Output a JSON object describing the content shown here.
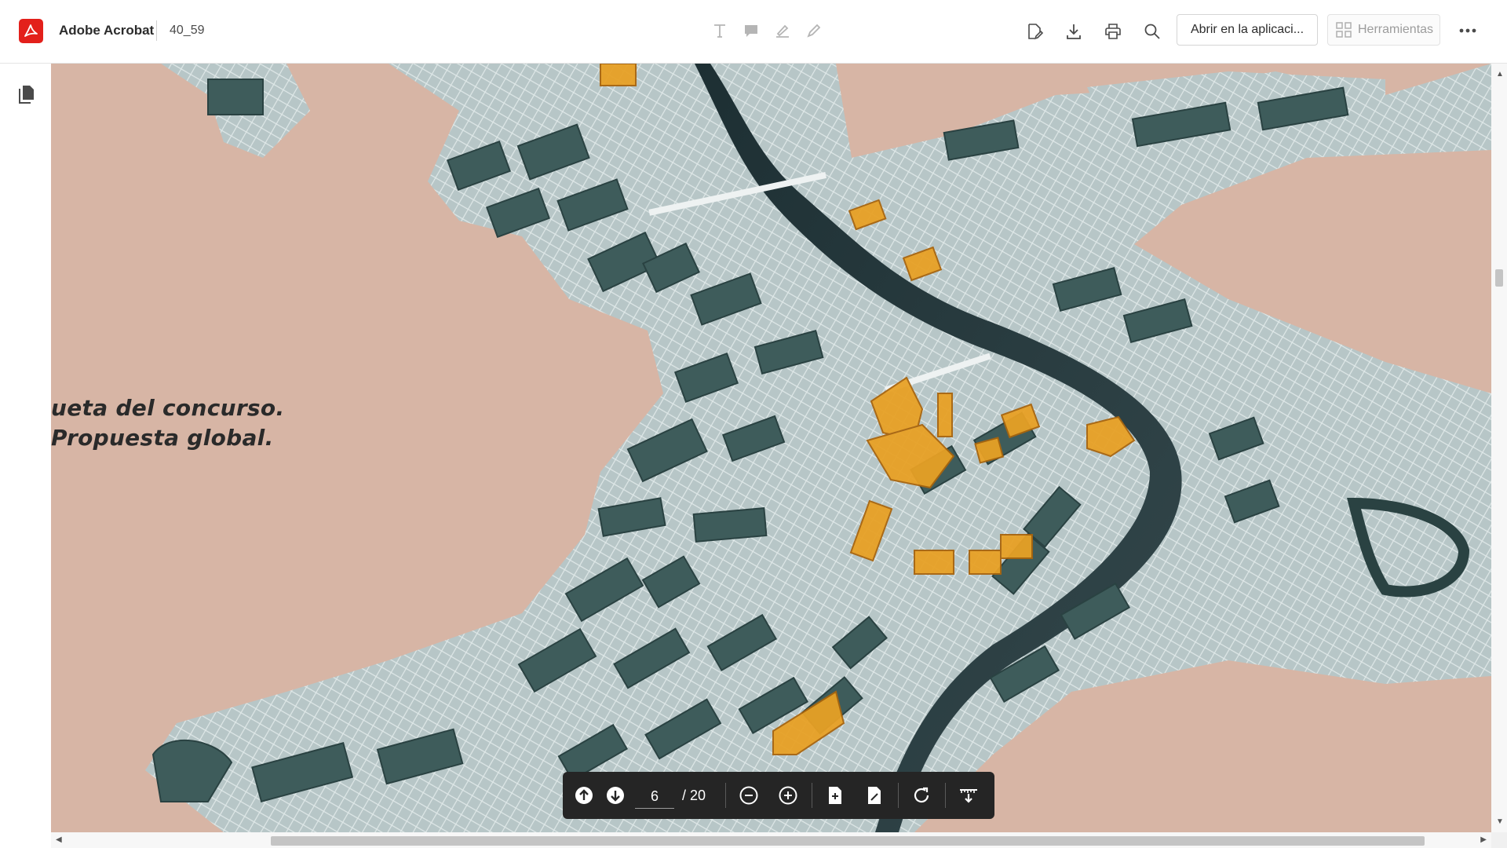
{
  "app": {
    "name": "Adobe Acrobat",
    "document_name": "40_59"
  },
  "toolbar": {
    "open_in_app_label": "Abrir en la aplicaci...",
    "tools_label": "Herramientas",
    "annotation_tools": [
      "text-tool-icon",
      "comment-icon",
      "highlight-icon",
      "pencil-icon"
    ],
    "right_icons": [
      "edit-pdf-icon",
      "download-icon",
      "print-icon",
      "search-icon"
    ]
  },
  "document": {
    "caption_line1": "ueta del concurso.",
    "caption_line2": "Propuesta global."
  },
  "page_nav": {
    "current_page": "6",
    "total_label": "/ 20"
  },
  "colors": {
    "acrobat_red": "#e3201b",
    "toolbar_dark": "#252525",
    "map_background": "#d7b5a5",
    "building_green": "#3e5c5b",
    "street_silver": "#b9c8c8",
    "highlight_orange": "#e7a125"
  }
}
